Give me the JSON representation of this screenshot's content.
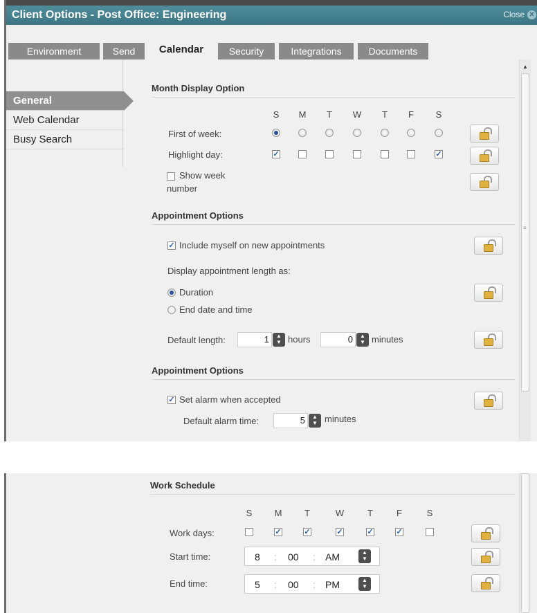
{
  "window": {
    "title": "Client Options - Post Office: Engineering",
    "close_label": "Close"
  },
  "tabs": [
    {
      "label": "Environment"
    },
    {
      "label": "Send"
    },
    {
      "label": "Calendar"
    },
    {
      "label": "Security"
    },
    {
      "label": "Integrations"
    },
    {
      "label": "Documents"
    }
  ],
  "nav": [
    {
      "label": "General"
    },
    {
      "label": "Web Calendar"
    },
    {
      "label": "Busy Search"
    }
  ],
  "days": [
    "S",
    "M",
    "T",
    "W",
    "T",
    "F",
    "S"
  ],
  "month_display": {
    "heading": "Month Display Option",
    "first_of_week_label": "First of week:",
    "first_of_week_selected": 0,
    "highlight_day_label": "Highlight day:",
    "highlight_checked": [
      true,
      false,
      false,
      false,
      false,
      false,
      true
    ],
    "show_week_label_1": "Show week",
    "show_week_label_2": "number",
    "show_week_checked": false
  },
  "appointment": {
    "heading": "Appointment Options",
    "include_label": "Include myself on new appointments",
    "include_checked": true,
    "display_length_label": "Display appointment length as:",
    "duration_label": "Duration",
    "end_label": "End date and time",
    "selected": "Duration",
    "default_length_label": "Default length:",
    "hours_value": "1",
    "hours_label": "hours",
    "minutes_value": "0",
    "minutes_label": "minutes"
  },
  "alarm": {
    "heading": "Appointment Options",
    "set_alarm_label": "Set alarm when accepted",
    "set_alarm_checked": true,
    "default_alarm_label": "Default alarm time:",
    "alarm_value": "5",
    "minutes_label": "minutes"
  },
  "work": {
    "heading": "Work Schedule",
    "work_days_label": "Work days:",
    "work_days_checked": [
      false,
      true,
      true,
      true,
      true,
      true,
      false
    ],
    "start_label": "Start time:",
    "start": {
      "hour": "8",
      "min": "00",
      "ampm": "AM"
    },
    "end_label": "End time:",
    "end": {
      "hour": "5",
      "min": "00",
      "ampm": "PM"
    },
    "sep": ":"
  },
  "colors": {
    "titlebar": "#4f8c9b",
    "tab_inactive": "#8a8a8a",
    "check": "#2a5aa8"
  }
}
